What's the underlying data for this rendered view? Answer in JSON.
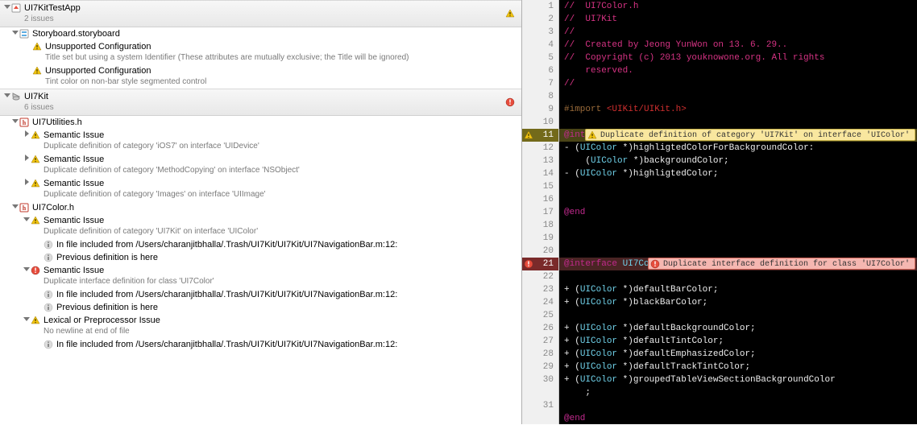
{
  "left": {
    "project": {
      "name": "UI7KitTestApp",
      "count": "2 issues"
    },
    "storyboard": {
      "file": "Storyboard.storyboard",
      "warn1_title": "Unsupported Configuration",
      "warn1_sub": "Title set but using a system Identifier (These attributes are mutually exclusive; the Title will be ignored)",
      "warn2_title": "Unsupported Configuration",
      "warn2_sub": "Tint color on non-bar style segmented control"
    },
    "lib": {
      "name": "UI7Kit",
      "count": "6 issues"
    },
    "util": {
      "file": "UI7Utilities.h",
      "w1_title": "Semantic Issue",
      "w1_sub": "Duplicate definition of category 'iOS7' on interface 'UIDevice'",
      "w2_title": "Semantic Issue",
      "w2_sub": "Duplicate definition of category 'MethodCopying' on interface 'NSObject'",
      "w3_title": "Semantic Issue",
      "w3_sub": "Duplicate definition of category 'Images' on interface 'UIImage'"
    },
    "color": {
      "file": "UI7Color.h",
      "w1_title": "Semantic Issue",
      "w1_sub": "Duplicate definition of category 'UI7Kit' on interface 'UIColor'",
      "i1": "In file included from /Users/charanjitbhalla/.Trash/UI7Kit/UI7Kit/UI7NavigationBar.m:12:",
      "i2": "Previous definition is here",
      "e1_title": "Semantic Issue",
      "e1_sub": "Duplicate interface definition for class 'UI7Color'",
      "i3": "In file included from /Users/charanjitbhalla/.Trash/UI7Kit/UI7Kit/UI7NavigationBar.m:12:",
      "i4": "Previous definition is here",
      "w2_title": "Lexical or Preprocessor Issue",
      "w2_sub": "No newline at end of file",
      "i5": "In file included from /Users/charanjitbhalla/.Trash/UI7Kit/UI7Kit/UI7NavigationBar.m:12:"
    }
  },
  "code": {
    "ann_warn": "Duplicate definition of category 'UI7Kit' on interface 'UIColor'",
    "ann_err": "Duplicate interface definition for class 'UI7Color'",
    "lines": [
      {
        "n": "1",
        "t": "//  UI7Color.h",
        "cls": "tok-comment"
      },
      {
        "n": "2",
        "t": "//  UI7Kit",
        "cls": "tok-comment"
      },
      {
        "n": "3",
        "t": "//",
        "cls": "tok-comment"
      },
      {
        "n": "4",
        "t": "//  Created by Jeong YunWon on 13. 6. 29..",
        "cls": "tok-comment"
      },
      {
        "n": "5",
        "t": "//  Copyright (c) 2013 youknowone.org. All rights",
        "cls": "tok-comment"
      },
      {
        "n": "6",
        "t": "    reserved.",
        "cls": "tok-comment"
      },
      {
        "n": "7",
        "t": "//",
        "cls": "tok-comment"
      },
      {
        "n": "8",
        "t": "",
        "cls": ""
      },
      {
        "n": "9",
        "seg": [
          {
            "t": "#import ",
            "cls": "tok-pre"
          },
          {
            "t": "<UIKit/UIKit.h>",
            "cls": "tok-str"
          }
        ]
      },
      {
        "n": "10",
        "t": "",
        "cls": ""
      },
      {
        "n": "11",
        "hl": "warn",
        "ann": "warn",
        "seg": [
          {
            "t": "@interface",
            "cls": "tok-kw"
          },
          {
            "t": " UIColor ",
            "cls": "tok-type"
          },
          {
            "t": "(UI7Kit)",
            "cls": "tok-plain"
          }
        ]
      },
      {
        "n": "12",
        "seg": [
          {
            "t": "- (",
            "cls": "tok-plain"
          },
          {
            "t": "UIColor",
            "cls": "tok-type"
          },
          {
            "t": " *)highligtedColorForBackgroundColor:",
            "cls": "tok-plain"
          }
        ]
      },
      {
        "n": "13",
        "seg": [
          {
            "t": "    (",
            "cls": "tok-plain"
          },
          {
            "t": "UIColor",
            "cls": "tok-type"
          },
          {
            "t": " *)backgroundColor;",
            "cls": "tok-plain"
          }
        ]
      },
      {
        "n": "14",
        "seg": [
          {
            "t": "- (",
            "cls": "tok-plain"
          },
          {
            "t": "UIColor",
            "cls": "tok-type"
          },
          {
            "t": " *)highligtedColor;",
            "cls": "tok-plain"
          }
        ]
      },
      {
        "n": "15",
        "t": "",
        "cls": ""
      },
      {
        "n": "16",
        "t": "",
        "cls": ""
      },
      {
        "n": "17",
        "seg": [
          {
            "t": "@end",
            "cls": "tok-kw"
          }
        ]
      },
      {
        "n": "18",
        "t": "",
        "cls": ""
      },
      {
        "n": "19",
        "t": "",
        "cls": ""
      },
      {
        "n": "20",
        "t": "",
        "cls": ""
      },
      {
        "n": "21",
        "hl": "err",
        "ann": "err",
        "seg": [
          {
            "t": "@interface",
            "cls": "tok-kw"
          },
          {
            "t": " UI7Color ",
            "cls": "tok-type"
          },
          {
            "t": ": ",
            "cls": "tok-plain"
          },
          {
            "t": " UIColor",
            "cls": "tok-type"
          }
        ]
      },
      {
        "n": "22",
        "t": "",
        "cls": ""
      },
      {
        "n": "23",
        "seg": [
          {
            "t": "+ (",
            "cls": "tok-plain"
          },
          {
            "t": "UIColor",
            "cls": "tok-type"
          },
          {
            "t": " *)defaultBarColor;",
            "cls": "tok-plain"
          }
        ]
      },
      {
        "n": "24",
        "seg": [
          {
            "t": "+ (",
            "cls": "tok-plain"
          },
          {
            "t": "UIColor",
            "cls": "tok-type"
          },
          {
            "t": " *)blackBarColor;",
            "cls": "tok-plain"
          }
        ]
      },
      {
        "n": "25",
        "t": "",
        "cls": ""
      },
      {
        "n": "26",
        "seg": [
          {
            "t": "+ (",
            "cls": "tok-plain"
          },
          {
            "t": "UIColor",
            "cls": "tok-type"
          },
          {
            "t": " *)defaultBackgroundColor;",
            "cls": "tok-plain"
          }
        ]
      },
      {
        "n": "27",
        "seg": [
          {
            "t": "+ (",
            "cls": "tok-plain"
          },
          {
            "t": "UIColor",
            "cls": "tok-type"
          },
          {
            "t": " *)defaultTintColor;",
            "cls": "tok-plain"
          }
        ]
      },
      {
        "n": "28",
        "seg": [
          {
            "t": "+ (",
            "cls": "tok-plain"
          },
          {
            "t": "UIColor",
            "cls": "tok-type"
          },
          {
            "t": " *)defaultEmphasizedColor;",
            "cls": "tok-plain"
          }
        ]
      },
      {
        "n": "29",
        "seg": [
          {
            "t": "+ (",
            "cls": "tok-plain"
          },
          {
            "t": "UIColor",
            "cls": "tok-type"
          },
          {
            "t": " *)defaultTrackTintColor;",
            "cls": "tok-plain"
          }
        ]
      },
      {
        "n": "30",
        "seg": [
          {
            "t": "+ (",
            "cls": "tok-plain"
          },
          {
            "t": "UIColor",
            "cls": "tok-type"
          },
          {
            "t": " *)groupedTableViewSectionBackgroundColor",
            "cls": "tok-plain"
          }
        ]
      },
      {
        "n": "",
        "t": "    ;",
        "cls": "tok-plain"
      },
      {
        "n": "31",
        "t": "",
        "cls": ""
      },
      {
        "n": "",
        "seg": [
          {
            "t": "@end",
            "cls": "tok-kw"
          }
        ]
      }
    ]
  }
}
